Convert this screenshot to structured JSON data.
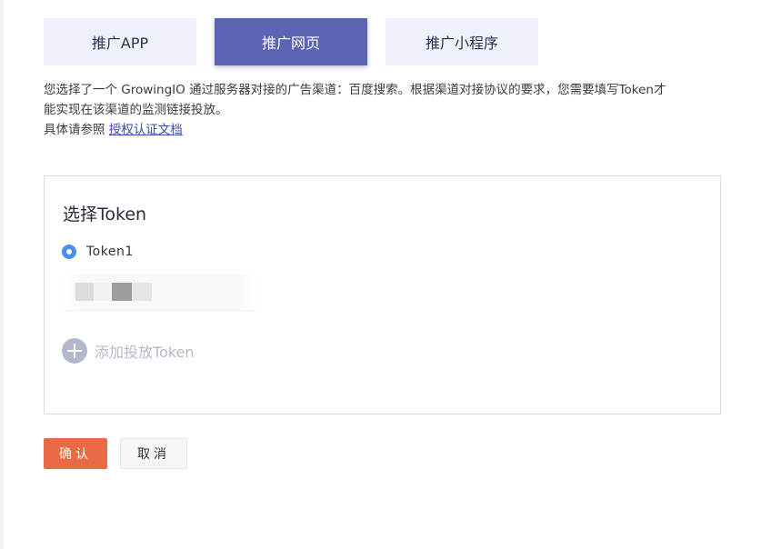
{
  "tabs": [
    {
      "label": "推广APP",
      "active": false
    },
    {
      "label": "推广网页",
      "active": true
    },
    {
      "label": "推广小程序",
      "active": false
    }
  ],
  "description": {
    "line1": "您选择了一个 GrowingIO 通过服务器对接的广告渠道：百度搜索。根据渠道对接协议的要求，您需要填写Token才",
    "line2": "能实现在该渠道的监测链接投放。",
    "line3_prefix": "具体请参照",
    "line3_link": "授权认证文档"
  },
  "panel": {
    "title": "选择Token",
    "selected_token": "Token1",
    "add_label": "添加投放Token"
  },
  "buttons": {
    "confirm": "确认",
    "cancel": "取消"
  },
  "colors": {
    "tab_active": "#5b63b3",
    "tab_inactive": "#eef0fa",
    "radio": "#4b8ef0",
    "confirm": "#ea6a45",
    "link": "#3d4aa8"
  },
  "icons": {
    "radio": "radio-selected-icon",
    "add": "plus-circle-icon"
  }
}
